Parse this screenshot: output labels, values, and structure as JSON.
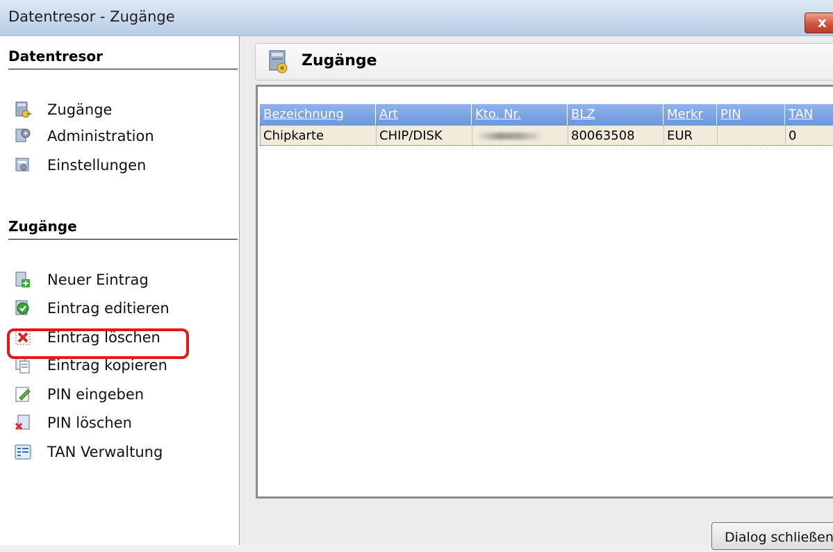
{
  "window": {
    "title": "Datentresor - Zugänge",
    "close_glyph": "x"
  },
  "sidebar": {
    "section1_title": "Datentresor",
    "section1_items": [
      {
        "label": "Zugänge",
        "icon": "vault-key-icon"
      },
      {
        "label": "Administration",
        "icon": "admin-gear-icon"
      },
      {
        "label": "Einstellungen",
        "icon": "settings-icon"
      }
    ],
    "section2_title": "Zugänge",
    "section2_items": [
      {
        "label": "Neuer Eintrag",
        "icon": "new-entry-icon"
      },
      {
        "label": "Eintrag editieren",
        "icon": "edit-entry-icon"
      },
      {
        "label": "Eintrag löschen",
        "icon": "delete-entry-icon"
      },
      {
        "label": "Eintrag kopieren",
        "icon": "copy-entry-icon"
      },
      {
        "label": "PIN eingeben",
        "icon": "pin-enter-icon"
      },
      {
        "label": "PIN löschen",
        "icon": "pin-delete-icon"
      },
      {
        "label": "TAN Verwaltung",
        "icon": "tan-manage-icon"
      }
    ]
  },
  "main": {
    "title": "Zugänge",
    "table": {
      "columns": [
        "Bezeichnung",
        "Art",
        "Kto. Nr.",
        "BLZ",
        "Merkr",
        "PIN",
        "TAN"
      ],
      "rows": [
        {
          "bezeichnung": "Chipkarte",
          "art": "CHIP/DISK",
          "kto": "",
          "blz": "80063508",
          "merkr": "EUR",
          "pin": "",
          "tan": "0"
        }
      ]
    },
    "close_button": "Dialog schließen"
  },
  "colors": {
    "header_blue": "#7aa3e5",
    "row_selected": "#f2ebdc",
    "highlight_red": "#e01818"
  }
}
